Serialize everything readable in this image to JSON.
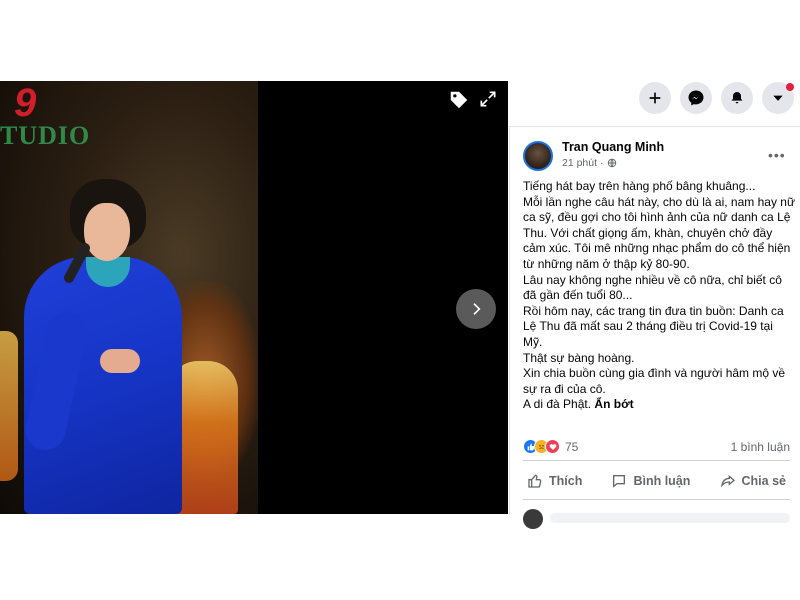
{
  "photo": {
    "logo_number": "9",
    "logo_text": "TUDIO"
  },
  "header_actions": [
    {
      "name": "create",
      "icon": "plus-icon"
    },
    {
      "name": "messenger",
      "icon": "messenger-icon"
    },
    {
      "name": "notifications",
      "icon": "bell-icon"
    },
    {
      "name": "account",
      "icon": "caret-down-icon"
    }
  ],
  "post": {
    "author": "Tran Quang Minh",
    "time": "21 phút",
    "privacy_separator": "·",
    "privacy_icon": "globe-icon",
    "lines": [
      "Tiếng hát bay trên hàng phố bâng khuâng...",
      "Mỗi lần nghe câu hát này, cho dù là ai, nam hay nữ ca sỹ, đều gợi cho tôi hình ảnh của nữ danh ca Lệ Thu. Với chất giọng ấm, khàn, chuyên chở đầy cảm xúc. Tôi mê những nhạc phẩm do cô thể hiện từ những năm ở thập kỷ 80-90.",
      "Lâu nay không nghe nhiều về cô nữa, chỉ biết cô đã gần đến tuổi 80...",
      "Rồi hôm nay, các trang tin đưa tin buồn: Danh ca Lệ Thu đã mất sau 2 tháng điều trị Covid-19 tại Mỹ.",
      "Thật sự bàng hoàng.",
      "Xin chia buồn cùng gia đình và người hâm mộ về sự ra đi của cô."
    ],
    "last_line": "A di đà Phật.",
    "see_less": "Ẩn bớt",
    "reaction_count": "75",
    "comment_count": "1 bình luận",
    "actions": {
      "like": "Thích",
      "comment": "Bình luận",
      "share": "Chia sẻ"
    }
  },
  "colors": {
    "accent": "#1877f2",
    "text_secondary": "#65676b",
    "button_bg": "#e4e6eb"
  }
}
